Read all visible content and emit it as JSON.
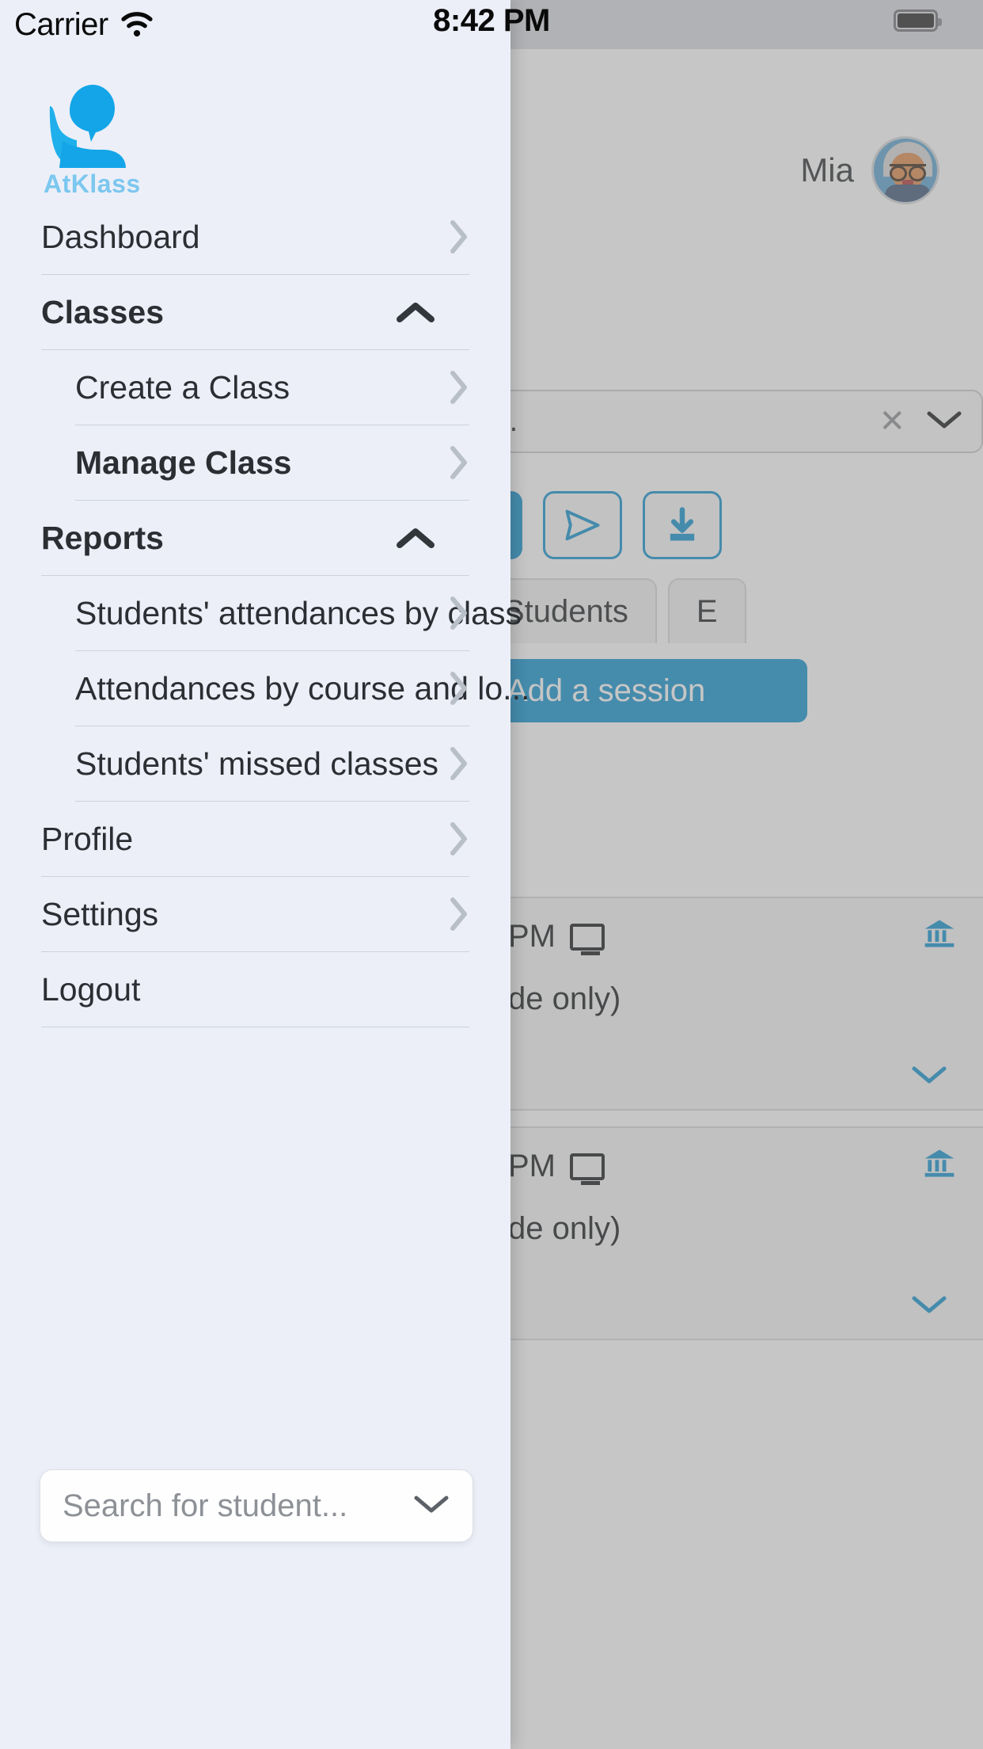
{
  "status_bar": {
    "carrier": "Carrier",
    "time": "8:42 PM",
    "wifi_icon": "wifi-icon",
    "battery_icon": "battery-full-icon"
  },
  "drawer": {
    "logo": {
      "icon": "atklass-person-logo",
      "wordmark": "AtKlass"
    },
    "menu": [
      {
        "label": "Dashboard",
        "level": 1,
        "bold": false,
        "arrow": "chevron-right-icon",
        "name": "dashboard"
      },
      {
        "label": "Classes",
        "level": 1,
        "bold": true,
        "arrow": "chevron-up-icon",
        "name": "classes"
      },
      {
        "label": "Create a Class",
        "level": 2,
        "bold": false,
        "arrow": "chevron-right-icon",
        "name": "create-a-class"
      },
      {
        "label": "Manage Class",
        "level": 2,
        "bold": true,
        "arrow": "chevron-right-icon",
        "name": "manage-class"
      },
      {
        "label": "Reports",
        "level": 1,
        "bold": true,
        "arrow": "chevron-up-icon",
        "name": "reports"
      },
      {
        "label": "Students' attendances by class",
        "level": 2,
        "bold": false,
        "arrow": "chevron-right-icon",
        "name": "students-attendances-by-class"
      },
      {
        "label": "Attendances by course and lo...",
        "level": 2,
        "bold": false,
        "arrow": "chevron-right-icon",
        "name": "attendances-by-course-and-location"
      },
      {
        "label": "Students' missed classes",
        "level": 2,
        "bold": false,
        "arrow": "chevron-right-icon",
        "name": "students-missed-classes"
      },
      {
        "label": "Profile",
        "level": 1,
        "bold": false,
        "arrow": "chevron-right-icon",
        "name": "profile"
      },
      {
        "label": "Settings",
        "level": 1,
        "bold": false,
        "arrow": "chevron-right-icon",
        "name": "settings"
      },
      {
        "label": "Logout",
        "level": 1,
        "bold": false,
        "arrow": "none",
        "name": "logout"
      }
    ],
    "search": {
      "placeholder": "Search for student...",
      "value": "",
      "dropdown_icon": "chevron-down-icon"
    }
  },
  "background": {
    "user": {
      "name": "Mia",
      "avatar": "user-avatar"
    },
    "course_select": {
      "text": "…ore… | …",
      "clear_icon": "close-icon",
      "dropdown_icon": "chevron-down-icon"
    },
    "actions": {
      "primary": "",
      "send_icon": "send-paper-plane-icon",
      "download_icon": "download-icon"
    },
    "tabs": [
      {
        "label": "Students"
      },
      {
        "label": "E"
      }
    ],
    "add_session_button": "Add a session",
    "cards": [
      {
        "time": "PM",
        "device_icon": "monitor-icon",
        "bank_icon": "institution-icon",
        "mode": "de only)",
        "expand_icon": "chevron-down-icon"
      },
      {
        "time": "PM",
        "device_icon": "monitor-icon",
        "bank_icon": "institution-icon",
        "mode": "de only)",
        "expand_icon": "chevron-down-icon"
      }
    ]
  },
  "colors": {
    "brand_blue": "#1293cf",
    "logo_light": "#7cc7ef",
    "drawer_bg": "#eceff8",
    "text": "#2b2f33",
    "divider": "#ccd1dc",
    "chevron_muted": "#b9bfc8"
  }
}
